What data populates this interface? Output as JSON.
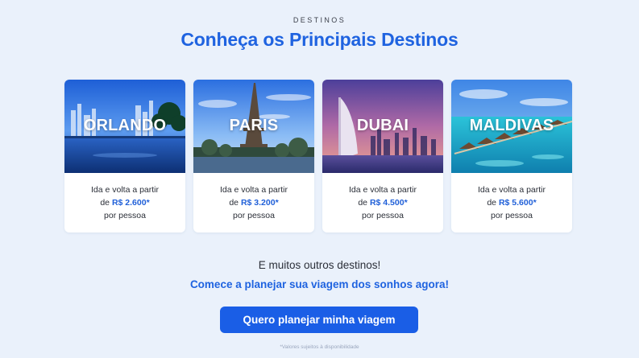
{
  "header": {
    "eyebrow": "DESTINOS",
    "title": "Conheça os Principais Destinos"
  },
  "destinations": [
    {
      "name": "ORLANDO",
      "line1": "Ida e volta a partir",
      "prefix": "de",
      "price": "R$ 2.600*",
      "line3": "por pessoa",
      "image": "orlando-skyline-lake-photo"
    },
    {
      "name": "PARIS",
      "line1": "Ida e volta a partir",
      "prefix": "de",
      "price": "R$ 3.200*",
      "line3": "por pessoa",
      "image": "paris-eiffel-tower-photo"
    },
    {
      "name": "DUBAI",
      "line1": "Ida e volta a partir",
      "prefix": "de",
      "price": "R$ 4.500*",
      "line3": "por pessoa",
      "image": "dubai-burj-al-arab-photo"
    },
    {
      "name": "MALDIVAS",
      "line1": "Ida e volta a partir",
      "prefix": "de",
      "price": "R$ 5.600*",
      "line3": "por pessoa",
      "image": "maldives-water-villas-photo"
    }
  ],
  "footer": {
    "more": "E muitos outros destinos!",
    "cta_text": "Comece a planejar sua viagem dos sonhos agora!",
    "button_label": "Quero planejar minha viagem",
    "disclaimer": "*Valores sujeitos à disponibilidade"
  },
  "colors": {
    "background": "#eaf1fb",
    "accent": "#1f63e0",
    "button": "#1a5ee6"
  }
}
